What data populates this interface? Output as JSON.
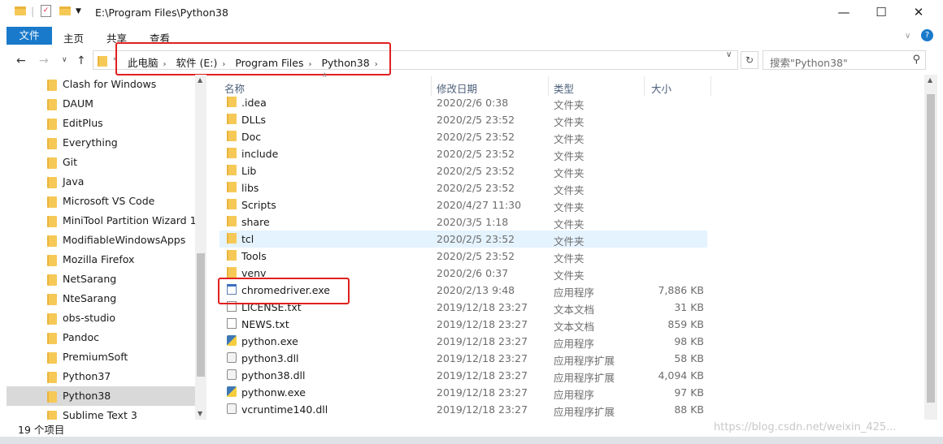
{
  "title_path": "E:\\Program Files\\Python38",
  "window": {
    "minimize": "—",
    "maximize": "☐",
    "close": "✕"
  },
  "ribbon": {
    "file": "文件",
    "home": "主页",
    "share": "共享",
    "view": "查看",
    "help": "?"
  },
  "breadcrumb": [
    "此电脑",
    "软件 (E:)",
    "Program Files",
    "Python38"
  ],
  "search_placeholder": "搜索\"Python38\"",
  "nav_items": [
    "Clash for Windows",
    "DAUM",
    "EditPlus",
    "Everything",
    "Git",
    "Java",
    "Microsoft VS Code",
    "MiniTool Partition Wizard 1",
    "ModifiableWindowsApps",
    "Mozilla Firefox",
    "NetSarang",
    "NteSarang",
    "obs-studio",
    "Pandoc",
    "PremiumSoft",
    "Python37",
    "Python38",
    "Sublime Text 3"
  ],
  "columns": {
    "name": "名称",
    "date": "修改日期",
    "type": "类型",
    "size": "大小"
  },
  "files": [
    {
      "name": ".idea",
      "date": "2020/2/6 0:38",
      "type": "文件夹",
      "size": "",
      "icon": "folder"
    },
    {
      "name": "DLLs",
      "date": "2020/2/5 23:52",
      "type": "文件夹",
      "size": "",
      "icon": "folder"
    },
    {
      "name": "Doc",
      "date": "2020/2/5 23:52",
      "type": "文件夹",
      "size": "",
      "icon": "folder"
    },
    {
      "name": "include",
      "date": "2020/2/5 23:52",
      "type": "文件夹",
      "size": "",
      "icon": "folder"
    },
    {
      "name": "Lib",
      "date": "2020/2/5 23:52",
      "type": "文件夹",
      "size": "",
      "icon": "folder"
    },
    {
      "name": "libs",
      "date": "2020/2/5 23:52",
      "type": "文件夹",
      "size": "",
      "icon": "folder"
    },
    {
      "name": "Scripts",
      "date": "2020/4/27 11:30",
      "type": "文件夹",
      "size": "",
      "icon": "folder"
    },
    {
      "name": "share",
      "date": "2020/3/5 1:18",
      "type": "文件夹",
      "size": "",
      "icon": "folder"
    },
    {
      "name": "tcl",
      "date": "2020/2/5 23:52",
      "type": "文件夹",
      "size": "",
      "icon": "folder"
    },
    {
      "name": "Tools",
      "date": "2020/2/5 23:52",
      "type": "文件夹",
      "size": "",
      "icon": "folder"
    },
    {
      "name": "venv",
      "date": "2020/2/6 0:37",
      "type": "文件夹",
      "size": "",
      "icon": "folder"
    },
    {
      "name": "chromedriver.exe",
      "date": "2020/2/13 9:48",
      "type": "应用程序",
      "size": "7,886 KB",
      "icon": "exe"
    },
    {
      "name": "LICENSE.txt",
      "date": "2019/12/18 23:27",
      "type": "文本文档",
      "size": "31 KB",
      "icon": "doc"
    },
    {
      "name": "NEWS.txt",
      "date": "2019/12/18 23:27",
      "type": "文本文档",
      "size": "859 KB",
      "icon": "doc"
    },
    {
      "name": "python.exe",
      "date": "2019/12/18 23:27",
      "type": "应用程序",
      "size": "98 KB",
      "icon": "py"
    },
    {
      "name": "python3.dll",
      "date": "2019/12/18 23:27",
      "type": "应用程序扩展",
      "size": "58 KB",
      "icon": "dll"
    },
    {
      "name": "python38.dll",
      "date": "2019/12/18 23:27",
      "type": "应用程序扩展",
      "size": "4,094 KB",
      "icon": "dll"
    },
    {
      "name": "pythonw.exe",
      "date": "2019/12/18 23:27",
      "type": "应用程序",
      "size": "97 KB",
      "icon": "py"
    },
    {
      "name": "vcruntime140.dll",
      "date": "2019/12/18 23:27",
      "type": "应用程序扩展",
      "size": "88 KB",
      "icon": "dll"
    }
  ],
  "status": "19 个项目",
  "watermark": "https://blog.csdn.net/weixin_425..."
}
